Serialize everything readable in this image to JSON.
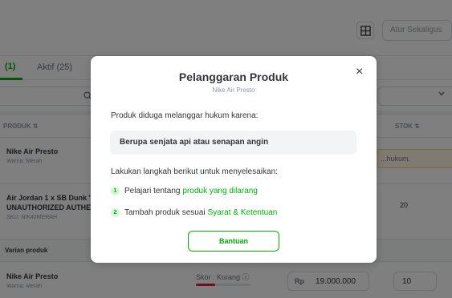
{
  "toolbar": {
    "bulk_label": "Atur Sekaligus"
  },
  "tabs": [
    {
      "label": "(1)"
    },
    {
      "label": "Aktif (25)"
    }
  ],
  "table": {
    "col_product": "PRODUK ⇅",
    "col_stock": "STOK ⇅"
  },
  "rows": [
    {
      "name": "Nike Air Presto",
      "sub": "Warna: Merah",
      "note": "...hukum."
    },
    {
      "name": "Air Jordan 1 x SB Dunk 'L...",
      "name2": "UNAUTHORIZED AUTHE...",
      "sub": "SKU: NIK42MERAH",
      "stock": "20"
    },
    {
      "section": "Varian produk"
    },
    {
      "name": "Nike Air Presto",
      "sub": "Warna: Merah",
      "score_label": "Skor : Kurang ⓘ",
      "score_level": 0.35,
      "price_prefix": "Rp",
      "price": "19.000.000",
      "stock": "10"
    }
  ],
  "modal": {
    "title": "Pelanggaran Produk",
    "subtitle": "Nike Air Presto",
    "intro": "Produk diduga melanggar hukum karena:",
    "reason": "Berupa senjata api atau senapan angin",
    "steps_title": "Lakukan langkah berikut untuk menyelesaikan:",
    "steps": [
      {
        "num": "1",
        "text": "Pelajari tentang",
        "link": "produk yang dilarang"
      },
      {
        "num": "2",
        "text": "Tambah produk sesuai",
        "link": "Syarat & Ketentuan"
      }
    ],
    "button": "Bantuan",
    "close_icon": "×"
  },
  "colors": {
    "accent": "#03ac0e",
    "danger": "#ef144a",
    "overlay": "rgba(0,0,0,0.5)"
  }
}
